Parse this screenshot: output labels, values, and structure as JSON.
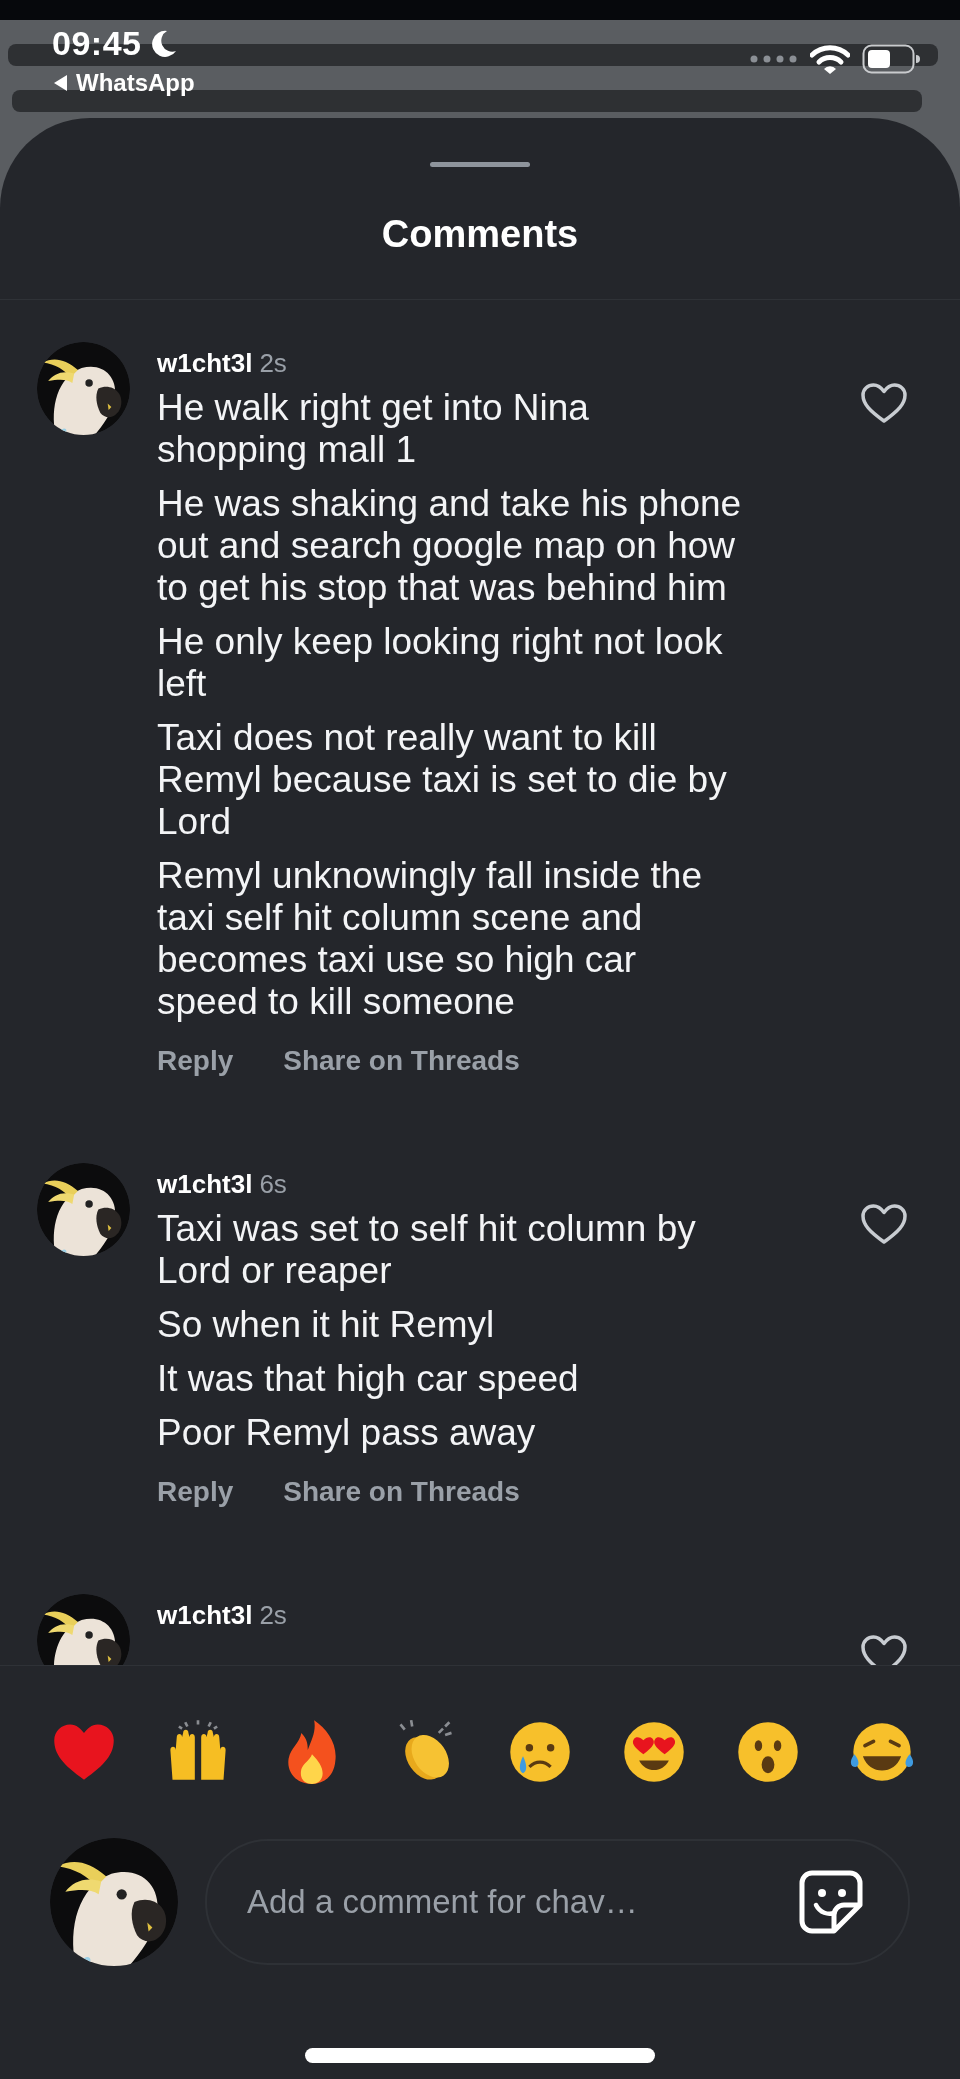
{
  "status_bar": {
    "time": "09:45",
    "back_label": "WhatsApp"
  },
  "sheet": {
    "title": "Comments"
  },
  "comments": [
    {
      "username": "w1cht3l",
      "time": "2s",
      "liked": false,
      "paragraphs": [
        "He walk right get into Nina shopping mall 1",
        "He was shaking and take his phone out and search google map on how to get his stop that was behind him",
        "He only keep looking right not look left",
        "Taxi does not really want to kill Remyl because taxi is set to die by Lord",
        "Remyl unknowingly fall inside the taxi self hit column scene and becomes taxi use so high car speed to kill someone"
      ],
      "actions": [
        "Reply",
        "Share on Threads"
      ]
    },
    {
      "username": "w1cht3l",
      "time": "6s",
      "liked": false,
      "paragraphs": [
        "Taxi was set to self hit column by Lord or reaper",
        "So when it hit Remyl",
        "It was that high car speed",
        "Poor Remyl pass away"
      ],
      "actions": [
        "Reply",
        "Share on Threads"
      ]
    },
    {
      "username": "w1cht3l",
      "time": "2s",
      "liked": false
    }
  ],
  "reactions": [
    {
      "kind": "heart"
    },
    {
      "kind": "raised-hands"
    },
    {
      "kind": "fire"
    },
    {
      "kind": "clap"
    },
    {
      "kind": "crying"
    },
    {
      "kind": "heart-eyes"
    },
    {
      "kind": "surprised"
    },
    {
      "kind": "laughing"
    }
  ],
  "composer": {
    "placeholder": "Add a comment for chav…"
  }
}
